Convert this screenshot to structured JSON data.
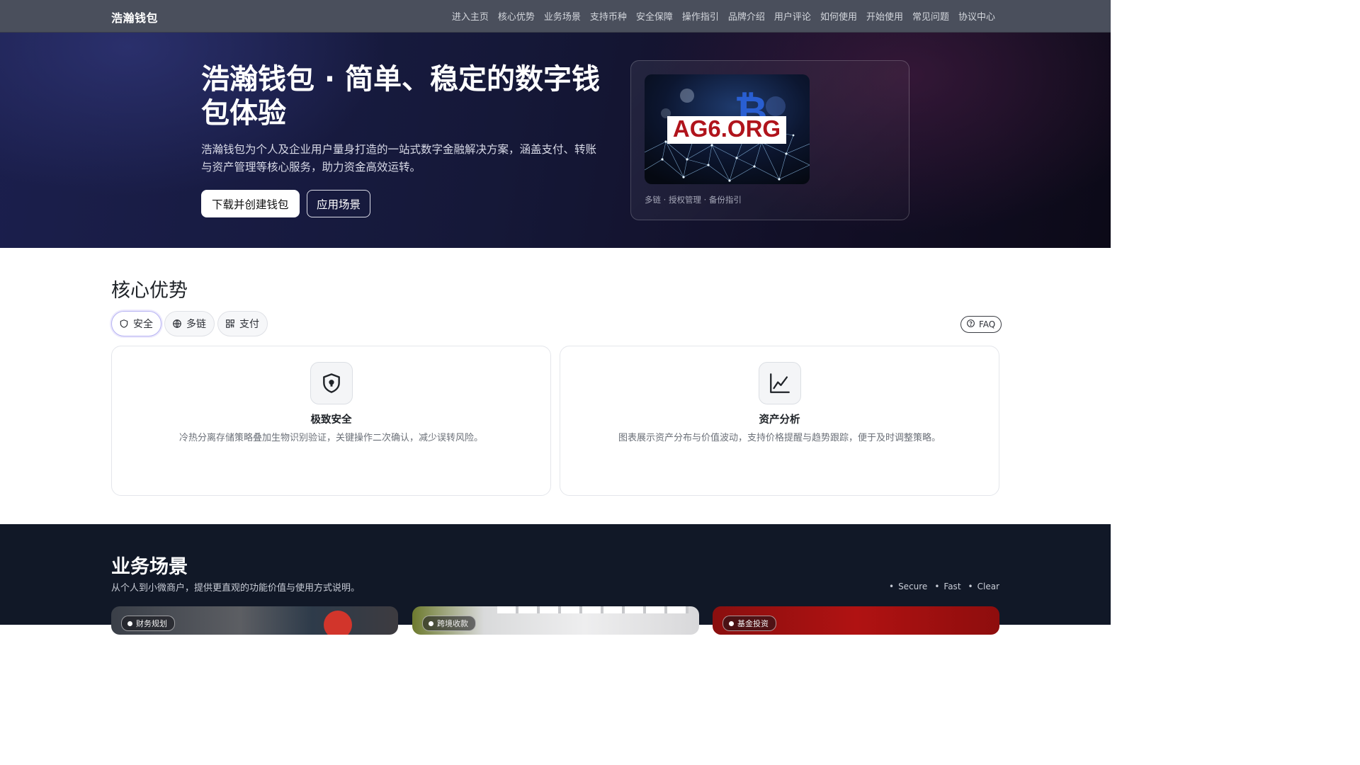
{
  "nav": {
    "brand": "浩瀚钱包",
    "links": [
      "进入主页",
      "核心优势",
      "业务场景",
      "支持币种",
      "安全保障",
      "操作指引",
      "品牌介绍",
      "用户评论",
      "如何使用",
      "开始使用",
      "常见问题",
      "协议中心"
    ]
  },
  "hero": {
    "title": "浩瀚钱包 · 简单、稳定的数字钱包体验",
    "description": "浩瀚钱包为个人及企业用户量身打造的一站式数字金融解决方案，涵盖支付、转账与资产管理等核心服务，助力资金高效运转。",
    "primary_button": "下载并创建钱包",
    "secondary_button": "应用场景",
    "image_text": "AG6.ORG",
    "caption": "多链 · 授权管理 · 备份指引"
  },
  "advantages": {
    "title": "核心优势",
    "chips": [
      {
        "label": "安全",
        "icon": "shield-icon"
      },
      {
        "label": "多链",
        "icon": "globe-icon"
      },
      {
        "label": "支付",
        "icon": "qr-code-icon"
      }
    ],
    "faq_label": "FAQ",
    "cards": [
      {
        "icon": "shield-lock-icon",
        "title": "极致安全",
        "description": "冷热分离存储策略叠加生物识别验证，关键操作二次确认，减少误转风险。"
      },
      {
        "icon": "line-chart-icon",
        "title": "资产分析",
        "description": "图表展示资产分布与价值波动，支持价格提醒与趋势跟踪，便于及时调整策略。"
      }
    ]
  },
  "scenes": {
    "title": "业务场景",
    "subtitle": "从个人到小微商户，提供更直观的功能价值与使用方式说明。",
    "tags": [
      "Secure",
      "Fast",
      "Clear"
    ],
    "cards": [
      {
        "badge": "财务规划"
      },
      {
        "badge": "跨境收款"
      },
      {
        "badge": "基金投资"
      }
    ]
  },
  "colors": {
    "nav_bg": "#4a4f5c",
    "hero_bg": "#151838",
    "dark_section_bg": "#111827",
    "chip_active_border": "#b7b4f3",
    "image_text": "#b0141c"
  }
}
